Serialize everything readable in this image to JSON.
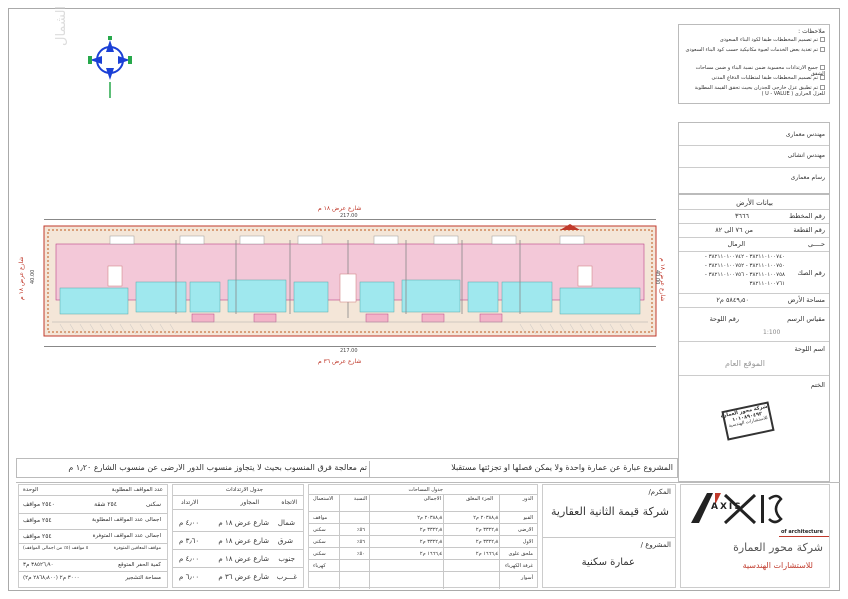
{
  "notes": {
    "title": "ملاحظات :",
    "items": [
      "تم تصميم المخططات طبقا لكود البناء السعودى",
      "تم تغذية بعض الخدمات لعبوة مكانيكية حسب كود البناء السعودى",
      "جميع الارتدادات محسوبة ضمن نسبة البناء و ضمن مساحات الشقق",
      "تم تصميم المخططات طبقا لمتطلبات الدفاع المدنى",
      "تم تطبيق عزل خارجى للجدران بحيث تحقق القيمة المطلوبة للعزل الحرارى ( U - VALUE )"
    ]
  },
  "roles": [
    "مهندس معمارى",
    "مهندس انشائى",
    "رسام معمارى"
  ],
  "land": {
    "title": "بيانات الأرض",
    "rows": [
      {
        "label": "رقم المخطط",
        "value": "٣٦٦٦"
      },
      {
        "label": "رقم القطعة",
        "value": "من ٧٦ الى ٨٢"
      },
      {
        "label": "حــــى",
        "value": "الرمال"
      },
      {
        "label": "رقم الصك",
        "value": "٣٨٢١١٠١٠٠٧٤٠ - ٣٨٢١١٠١٠٠٧٤٢ - ٣٨٢١١٠١٠٠٧٥٠ - ٣٨٢١١٠١٠٠٧٥٢ - ٣٨٢١١٠١٠٠٧٥٨ - ٣٨٢١١٠١٠٠٧٥٦ - ٣٨٢١١٠١٠٠٧٦١"
      },
      {
        "label": "مساحة الأرض",
        "value": "٥٨٤٩٫٥٠ م٢"
      }
    ],
    "scale_label": "مقياس الرسم",
    "sheet_no_label": "رقم اللوحة",
    "scale_value": "1:100",
    "sheet_name_label": "اسم اللوحة",
    "sheet_name_value": "الموقع العام",
    "stamp_label": "الختم"
  },
  "stamp": {
    "line1": "شركة محور العمارة",
    "line2": "١٠١٠٨٩٠٤٩٢",
    "line3": "للاستشارات الهندسية"
  },
  "client": {
    "label": "المكرم/",
    "name": "شركة قيمة الثانية العقارية",
    "project_label": "المشروع /",
    "project_name": "عمارة سكنية"
  },
  "logo": {
    "brand": "AXIS",
    "tag": "of architecture",
    "company": "شركة محور العمارة",
    "sub": "للاستشارات الهندسية"
  },
  "plan": {
    "north_label": "الشمال",
    "street_top": "شارع عرض ١٨ م",
    "street_bottom": "شارع عرض ٣٦ م",
    "street_left": "شارع عرض ١٨ م",
    "street_right": "شارع عرض ١٨ م",
    "dim_top": "217.00",
    "dim_bottom": "217.00",
    "dim_left": "40.00",
    "dim_right": "40.00"
  },
  "statements": {
    "left": "تم معالجة فرق المنسوب بحيث لا يتجاوز منسوب الدور الارضى عن منسوب الشارع ١٫٢٠ م",
    "right": "المشروع عبارة عن عمارة واحدة ولا يمكن فصلها او تجزئتها مستقبلا"
  },
  "parking": {
    "title": "عدد المواقف المطلوبة",
    "unit_header": "الوحدة",
    "rows": [
      {
        "label": "سكنى",
        "count": "٢٥٤ شقة",
        "value": "٢٥٤٠ مواقف"
      },
      {
        "label": "اجمالى عدد المواقف المطلوبة",
        "value": "٢٥٤ مواقف"
      },
      {
        "label": "اجمالى عدد المواقف المتوفرة",
        "value": "٢٥٤ مواقف"
      },
      {
        "label": "مواقف المعاقين المتوفرة",
        "value": "٥ مواقف (٥٪ من اجمالى المواقف)"
      },
      {
        "label": "كمية الحفر المتوقع",
        "value": "٣٨٥٢٦٫٩٠ م٣"
      },
      {
        "label": "مساحة التشجير",
        "value": "٣٠٠٠ م٢ (٢٨٦٨٫٨٠٠ م٢)"
      }
    ]
  },
  "setbacks": {
    "title": "جدول الارتدادات",
    "headers": [
      "الاتجاه",
      "المجاور",
      "الارتداد"
    ],
    "rows": [
      {
        "dir": "شمال",
        "neighbor": "شارع عرض ١٨ م",
        "value": "٤٫٠٠ م"
      },
      {
        "dir": "شرق",
        "neighbor": "شارع عرض ١٨ م",
        "value": "٣٫٦٠ م"
      },
      {
        "dir": "جنوب",
        "neighbor": "شارع عرض ١٨ م",
        "value": "٤٫٠٠ م"
      },
      {
        "dir": "غـــرب",
        "neighbor": "شارع عرض ٣٦ م",
        "value": "٦٫٠٠ م"
      }
    ]
  },
  "areas": {
    "title": "جدول المساحات",
    "headers": [
      "الدور",
      "الجزء المغلق",
      "الاجمالى",
      "النسبة",
      "الاستعمال"
    ],
    "rows": [
      {
        "floor": "القبو",
        "closed": "٢٠٣٨٨٫٨٠ م٢",
        "total": "٢٠٣٨٨٫٨٠ م٢",
        "ratio": "",
        "use": "مواقف"
      },
      {
        "floor": "الارضى",
        "closed": "٣٣٢٢٫٨٠ م٢",
        "total": "٣٣٢٢٫٨٠ م٢",
        "ratio": "٥٦٪",
        "use": "سكنى"
      },
      {
        "floor": "الاول",
        "closed": "٣٣٢٢٫٨٠ م٢",
        "total": "٣٣٢٢٫٨٠ م٢",
        "ratio": "٥٦٪",
        "use": "سكنى"
      },
      {
        "floor": "ملحق علوى",
        "closed": "١٦٦٦٫٤٠ م٢",
        "total": "١٦٦٦٫٤٠ م٢",
        "ratio": "٥٠٪",
        "use": "سكنى"
      },
      {
        "floor": "غرفة الكهرباء",
        "closed": "",
        "total": "",
        "ratio": "",
        "use": "كهرباء"
      },
      {
        "floor": "أسوار",
        "closed": "",
        "total": "",
        "ratio": "",
        "use": ""
      }
    ]
  }
}
